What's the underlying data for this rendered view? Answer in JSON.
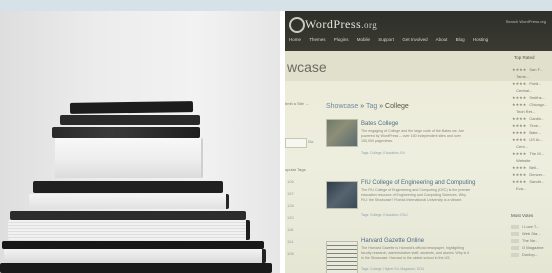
{
  "left_photo": {
    "subject": "stack-of-books",
    "background_color": "#ececec",
    "book_colors": [
      "#1c1c1c",
      "#242424",
      "#f6f6f6",
      "#2a2a2a",
      "#efefef",
      "#1e1e1e",
      "#f3f3f3",
      "#262626"
    ]
  },
  "right_photo": {
    "site": {
      "logo_text": "WordPress",
      "logo_suffix": ".org",
      "nav": [
        "Home",
        "Themes",
        "Plugins",
        "Mobile",
        "Support",
        "Get Involved",
        "About",
        "Blog",
        "Hosting"
      ],
      "top_right": "Search WordPress.org"
    },
    "page_title": "wcase",
    "sidebar": {
      "submit_link": "bmit a Site →",
      "search_button": "Go",
      "tags_label": "opular Tags",
      "numbers": [
        "106",
        "157",
        "128",
        "120",
        "118",
        "114",
        "108"
      ]
    },
    "breadcrumb": {
      "link": "Showcase",
      "sep": " » ",
      "middle": "Tag",
      "current": "College"
    },
    "entries": [
      {
        "title": "Bates College",
        "text": "The engaging of College and the large code of the Bates we. Are powered by WordPress -- over 150 independent sites and over 150,000 pageviews.",
        "tags": "Tags: College, Education, Ed"
      },
      {
        "title": "FIU College of Engineering and Computing",
        "text": "The FIU College of Engineering and Computing (CEC) is the premier education resource of Engineering and Computing Sciences. Why FIU: the Showcase? Florida International University is a vibrant.",
        "tags": "Tags: College, Education, EDU"
      },
      {
        "title": "Harvard Gazette Online",
        "text": "The Harvard Gazette is Harvard's official newspaper, highlighting faculty research, administrative staff, students, and alumni. Why is it in the Showcase: Harvard is the oldest school in the US.",
        "tags": "Tags: College, Higher Ed, Magazine, EDU"
      }
    ],
    "top_rated": {
      "heading": "Top Rated",
      "items": [
        "San F...",
        "Tame...",
        "Publi...",
        "Central...",
        "Smiths...",
        "Chicago...",
        "Tech Ret...",
        "Cardin...",
        "Time...",
        "Bate...",
        "US Ar...",
        "Cent...",
        "The M...",
        "Website",
        "Bell...",
        "Denver...",
        "Sandtr...",
        "Eva..."
      ]
    },
    "most_votes": {
      "heading": "Most Votes",
      "items": [
        "I Love T...",
        "Web Sta...",
        "The Ne...",
        "O Magazine",
        "Dunlop..."
      ]
    }
  }
}
